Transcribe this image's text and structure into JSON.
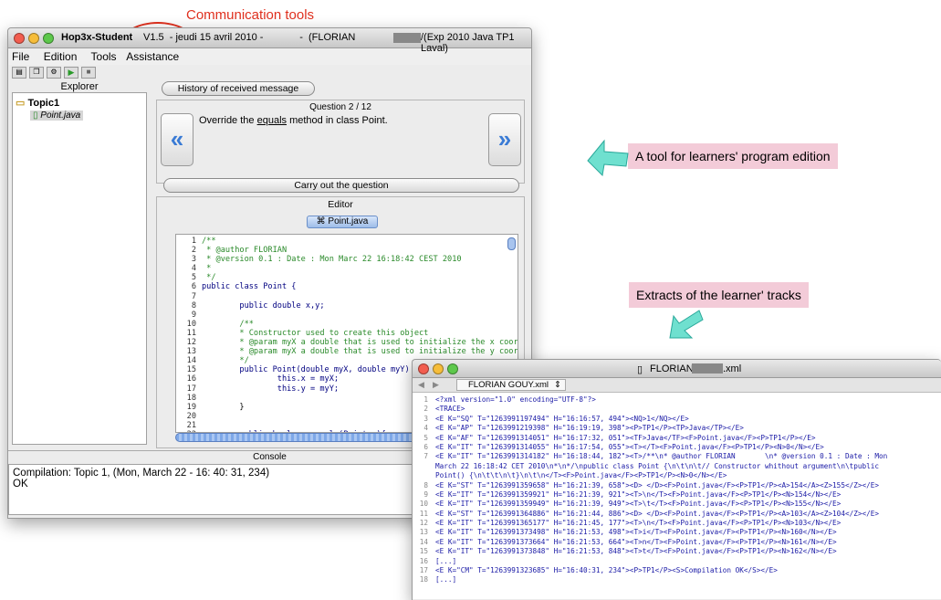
{
  "annotations": {
    "communication_tools": "Communication tools",
    "program_edition": "A tool for learners' program edition",
    "tracks": "Extracts of the learner' tracks"
  },
  "main_window": {
    "title_app": "Hop3x-Student",
    "title_rest": "V1.5  - jeudi 15 avril 2010 -             -  (FLORIAN",
    "title_end": "/(Exp 2010 Java TP1 Laval)",
    "menu": [
      "File",
      "Edition",
      "Tools",
      "Assistance"
    ],
    "explorer": {
      "title": "Explorer",
      "folder": "Topic1",
      "file": "Point.java"
    },
    "history_button": "History of received message",
    "question": {
      "counter": "Question 2 / 12",
      "text_before": "Override the ",
      "text_link": "equals",
      "text_after": " method in class Point.",
      "prev": "«",
      "next": "»"
    },
    "carry_button": "Carry out the question",
    "editor": {
      "title": "Editor",
      "tab": "Point.java",
      "lines": [
        {
          "n": "1",
          "t": "/**",
          "c": "comment"
        },
        {
          "n": "2",
          "t": " * @author FLORIAN ",
          "c": "comment"
        },
        {
          "n": "3",
          "t": " * @version 0.1 : Date : Mon Marc 22 16:18:42 CEST 2010",
          "c": "comment"
        },
        {
          "n": "4",
          "t": " *",
          "c": "comment"
        },
        {
          "n": "5",
          "t": " */",
          "c": "comment"
        },
        {
          "n": "6",
          "t": "public class Point {",
          "c": "kw"
        },
        {
          "n": "7",
          "t": "",
          "c": "code"
        },
        {
          "n": "8",
          "t": "        public double x,y;",
          "c": "kw"
        },
        {
          "n": "9",
          "t": "",
          "c": "code"
        },
        {
          "n": "10",
          "t": "        /**",
          "c": "comment"
        },
        {
          "n": "11",
          "t": "        * Constructor used to create this object",
          "c": "comment"
        },
        {
          "n": "12",
          "t": "        * @param myX a double that is used to initialize the x coordi",
          "c": "comment"
        },
        {
          "n": "13",
          "t": "        * @param myX a double that is used to initialize the y coordi",
          "c": "comment"
        },
        {
          "n": "14",
          "t": "        */",
          "c": "comment"
        },
        {
          "n": "15",
          "t": "        public Point(double myX, double myY) {",
          "c": "kw"
        },
        {
          "n": "16",
          "t": "                this.x = myX;",
          "c": "kw"
        },
        {
          "n": "17",
          "t": "                this.y = myY;",
          "c": "kw"
        },
        {
          "n": "18",
          "t": "",
          "c": "code"
        },
        {
          "n": "19",
          "t": "        }",
          "c": "code"
        },
        {
          "n": "20",
          "t": "",
          "c": "code"
        },
        {
          "n": "21",
          "t": "",
          "c": "code"
        },
        {
          "n": "22",
          "t": "        public boolean equals(Point p){",
          "c": "kw"
        }
      ]
    },
    "console": {
      "title": "Console",
      "line1": "Compilation: Topic 1, (Mon, March 22 - 16: 40: 31, 234)",
      "line2": "OK"
    }
  },
  "xml_window": {
    "title": "FLORIAN",
    "title_ext": ".xml",
    "tab": "FLORIAN GOUY.xml",
    "lines": [
      {
        "n": "1",
        "t": "<?xml version=\"1.0\" encoding=\"UTF-8\"?>"
      },
      {
        "n": "2",
        "t": "<TRACE>"
      },
      {
        "n": "3",
        "t": "<E K=\"SQ\" T=\"1263991197494\" H=\"16:16:57, 494\"><NQ>1</NQ></E>"
      },
      {
        "n": "4",
        "t": "<E K=\"AP\" T=\"1263991219398\" H=\"16:19:19, 398\"><P>TP1</P><TP>Java</TP></E>"
      },
      {
        "n": "5",
        "t": "<E K=\"AF\" T=\"1263991314051\" H=\"16:17:32, 051\"><TF>Java</TF><F>Point.java</F><P>TP1</P></E>"
      },
      {
        "n": "6",
        "t": "<E K=\"IT\" T=\"1263991314055\" H=\"16:17:54, 055\"><T></T><F>Point.java</F><P>TP1</P><N>0</N></E>"
      },
      {
        "n": "7",
        "t": "<E K=\"IT\" T=\"1263991314182\" H=\"16:18:44, 182\"><T>/**\\n* @author FLORIAN       \\n* @version 0.1 : Date : Mon"
      },
      {
        "n": "",
        "t": "March 22 16:18:42 CET 2010\\n*\\n*/\\npublic class Point {\\n\\t\\n\\t// Constructor whithout argument\\n\\tpublic"
      },
      {
        "n": "",
        "t": "Point() {\\n\\t\\t\\n\\t}\\n\\t\\n</T><F>Point.java</F><P>TP1</P><N>0</N></E>"
      },
      {
        "n": "8",
        "t": "<E K=\"ST\" T=\"1263991359658\" H=\"16:21:39, 658\"><D> </D><F>Point.java</F><P>TP1</P><A>154</A><Z>155</Z></E>"
      },
      {
        "n": "9",
        "t": "<E K=\"IT\" T=\"1263991359921\" H=\"16:21:39, 921\"><T>\\n</T><F>Point.java</F><P>TP1</P><N>154</N></E>"
      },
      {
        "n": "10",
        "t": "<E K=\"IT\" T=\"1263991359949\" H=\"16:21:39, 949\"><T>\\t</T><F>Point.java</F><P>TP1</P><N>155</N></E>"
      },
      {
        "n": "11",
        "t": "<E K=\"ST\" T=\"1263991364886\" H=\"16:21:44, 886\"><D> </D><F>Point.java</F><P>TP1</P><A>103</A><Z>104</Z></E>"
      },
      {
        "n": "12",
        "t": "<E K=\"IT\" T=\"1263991365177\" H=\"16:21:45, 177\"><T>\\n</T><F>Point.java</F><P>TP1</P><N>103</N></E>"
      },
      {
        "n": "13",
        "t": "<E K=\"IT\" T=\"1263991373498\" H=\"16:21:53, 498\"><T>i</T><F>Point.java</F><P>TP1</P><N>160</N></E>"
      },
      {
        "n": "14",
        "t": "<E K=\"IT\" T=\"1263991373664\" H=\"16:21:53, 664\"><T>n</T><F>Point.java</F><P>TP1</P><N>161</N></E>"
      },
      {
        "n": "15",
        "t": "<E K=\"IT\" T=\"1263991373848\" H=\"16:21:53, 848\"><T>t</T><F>Point.java</F><P>TP1</P><N>162</N></E>"
      },
      {
        "n": "16",
        "t": "[...]"
      },
      {
        "n": "17",
        "t": "<E K=\"CM\" T=\"1263991323685\" H=\"16:40:31, 234\"><P>TP1</P><S>Compilation OK</S></E>"
      },
      {
        "n": "18",
        "t": "[...]"
      }
    ]
  },
  "colors": {
    "comment": "#2a8a2a",
    "keyword": "#000080",
    "accent": "#3a7bd5",
    "callout": "#f3cbd8",
    "arrow": "#6fe0cf",
    "annot": "#e0301e"
  }
}
